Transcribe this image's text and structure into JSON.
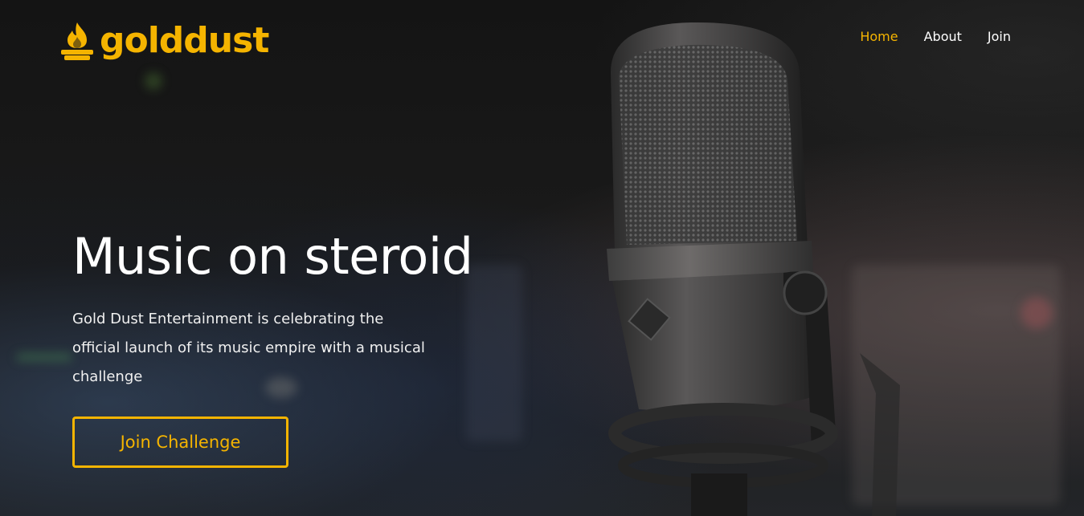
{
  "brand": {
    "name": "golddust",
    "accent_color": "#f5b400",
    "logo_icon": "flame-icon"
  },
  "nav": {
    "items": [
      {
        "label": "Home",
        "active": true
      },
      {
        "label": "About",
        "active": false
      },
      {
        "label": "Join",
        "active": false
      }
    ]
  },
  "hero": {
    "title": "Music on steroid",
    "description": "Gold Dust Entertainment is celebrating the official launch of its music empire with a musical challenge",
    "cta_label": "Join Challenge",
    "background": "studio-microphone-photo"
  }
}
